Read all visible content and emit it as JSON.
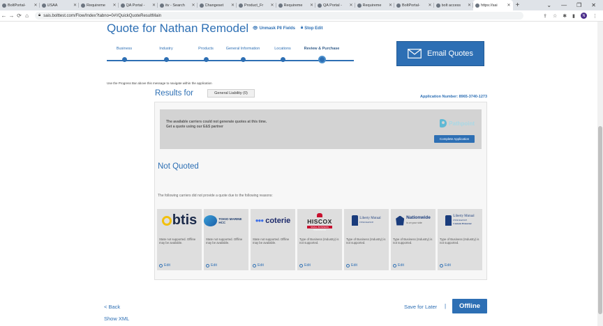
{
  "browser": {
    "tabs": [
      {
        "label": "BoltPortal-"
      },
      {
        "label": "USAA"
      },
      {
        "label": "Requireme"
      },
      {
        "label": "QA Portal -"
      },
      {
        "label": "itv - Search"
      },
      {
        "label": "Changeset"
      },
      {
        "label": "Product_Fr"
      },
      {
        "label": "Requireme"
      },
      {
        "label": "QA Portal -"
      },
      {
        "label": "Requireme"
      },
      {
        "label": "BoltPortal-"
      },
      {
        "label": "bolt access"
      },
      {
        "label": "https://sai"
      }
    ],
    "new_tab": "+",
    "url": "sais.bolttest.com/Flow/Index?tabno=0#!/QuickQuoteResultMain",
    "profile_initial": "N"
  },
  "page": {
    "title": "Quote for Nathan Remodel",
    "unmask_label": "Unmask PII Fields",
    "stop_edit_label": "Stop Edit",
    "progress_steps": [
      {
        "label": "Business"
      },
      {
        "label": "Industry"
      },
      {
        "label": "Products"
      },
      {
        "label": "General Information"
      },
      {
        "label": "Locations"
      },
      {
        "label": "Review & Purchase"
      }
    ],
    "email_quotes_label": "Email Quotes",
    "hint": "Use the Progress Bar above this message to navigate within the application",
    "results_for": "Results for",
    "gl_tab": "General Liability (0)",
    "application_number": "Application Number: 8965-3740-1273",
    "alert_line1": "The available carriers could not generate quotes at this time.",
    "alert_line2": "Get a quote using our E&S partner",
    "pathpoint_name": "Pathpoint",
    "complete_application": "Complete Application",
    "not_quoted": "Not Quoted",
    "reasons_text": "The following carriers did not provide a quote due to the following reasons:",
    "carriers": [
      {
        "name": "btis",
        "message": "State not supported. Offline may be available.",
        "edit": "Edit"
      },
      {
        "name": "TOKIO MARINE HCC",
        "message": "State not supported. Offline may be available.",
        "edit": "Edit"
      },
      {
        "name": "coterie",
        "message": "State not supported. Offline may be available.",
        "edit": "Edit"
      },
      {
        "name": "HISCOX",
        "tagline": "SMALL BUSINESS INSURANCE",
        "message": "Type of Business (Industry) is not supported.",
        "edit": "Edit"
      },
      {
        "name": "Liberty Mutual",
        "tagline": "INSURANCE",
        "message": "Type of Business (Industry) is not supported.",
        "edit": "Edit"
      },
      {
        "name": "Nationwide",
        "tagline": "is on your side",
        "message": "Type of Business (Industry) is not supported.",
        "edit": "Edit"
      },
      {
        "name": "Liberty Mutual",
        "tagline": "INSURANCE",
        "subtag": "Custom Protector",
        "message": "Type of Business (Industry) is not supported.",
        "edit": "Edit"
      }
    ],
    "back_label": "< Back",
    "show_xml_label": "Show XML",
    "save_later_label": "Save for Later",
    "separator": "|",
    "offline_label": "Offline"
  },
  "colors": {
    "accent": "#2d6fb4",
    "alert_bg": "#d3d3d3",
    "card_bg": "#dedede",
    "hiscox_red": "#c8102e"
  }
}
